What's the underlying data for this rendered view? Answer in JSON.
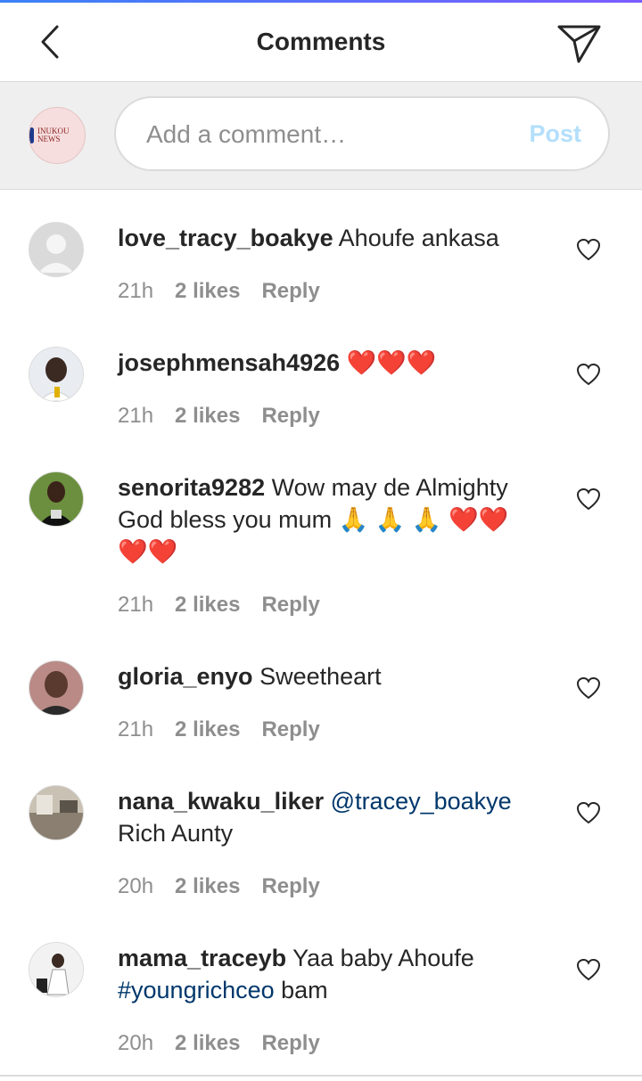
{
  "header": {
    "title": "Comments"
  },
  "compose": {
    "placeholder": "Add a comment…",
    "post_label": "Post",
    "avatar_text": "INUKOU NEWS"
  },
  "comments": [
    {
      "user": "love_tracy_boakye",
      "text": "Ahoufe ankasa",
      "time": "21h",
      "likes": "2 likes",
      "reply": "Reply"
    },
    {
      "user": "josephmensah4926",
      "text": "❤️❤️❤️",
      "time": "21h",
      "likes": "2 likes",
      "reply": "Reply"
    },
    {
      "user": "senorita9282",
      "text": "Wow may de Almighty God bless you mum 🙏 🙏 🙏 ❤️❤️❤️❤️",
      "time": "21h",
      "likes": "2 likes",
      "reply": "Reply"
    },
    {
      "user": "gloria_enyo",
      "text": "Sweetheart",
      "time": "21h",
      "likes": "2 likes",
      "reply": "Reply"
    },
    {
      "user": "nana_kwaku_liker",
      "mention": "@tracey_boakye",
      "text": "Rich Aunty",
      "time": "20h",
      "likes": "2 likes",
      "reply": "Reply"
    },
    {
      "user": "mama_traceyb",
      "text": "Yaa baby Ahoufe",
      "hashtag": "#youngrichceo",
      "text2": "bam",
      "time": "20h",
      "likes": "2 likes",
      "reply": "Reply"
    }
  ]
}
